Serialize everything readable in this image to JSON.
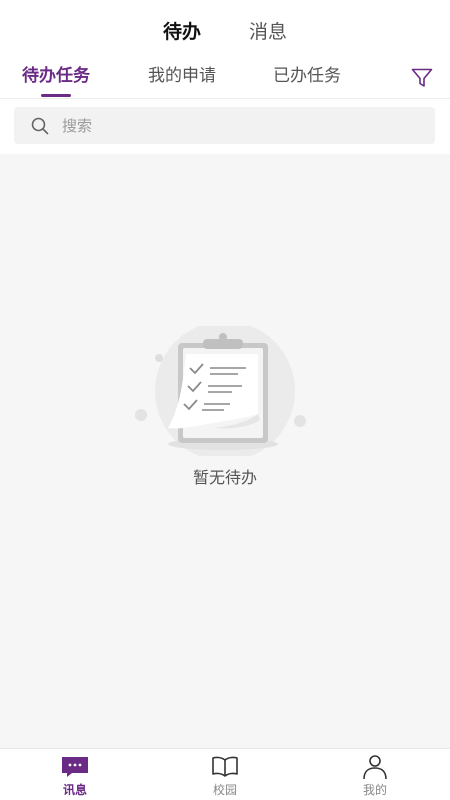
{
  "top_tabs": [
    {
      "label": "待办",
      "active": true
    },
    {
      "label": "消息",
      "active": false
    }
  ],
  "sub_tabs": [
    {
      "label": "待办任务",
      "active": true
    },
    {
      "label": "我的申请",
      "active": false
    },
    {
      "label": "已办任务",
      "active": false
    }
  ],
  "filter": {
    "icon": "filter-icon"
  },
  "search": {
    "placeholder": "搜索",
    "value": "",
    "icon": "search-icon"
  },
  "empty_state": {
    "icon": "clipboard-checklist-icon",
    "text": "暂无待办"
  },
  "bottom_nav": [
    {
      "label": "讯息",
      "icon": "message-icon",
      "active": true
    },
    {
      "label": "校园",
      "icon": "book-icon",
      "active": false
    },
    {
      "label": "我的",
      "icon": "user-icon",
      "active": false
    }
  ],
  "colors": {
    "accent": "#6a2a86",
    "background": "#f6f6f6",
    "text": "#333333"
  }
}
